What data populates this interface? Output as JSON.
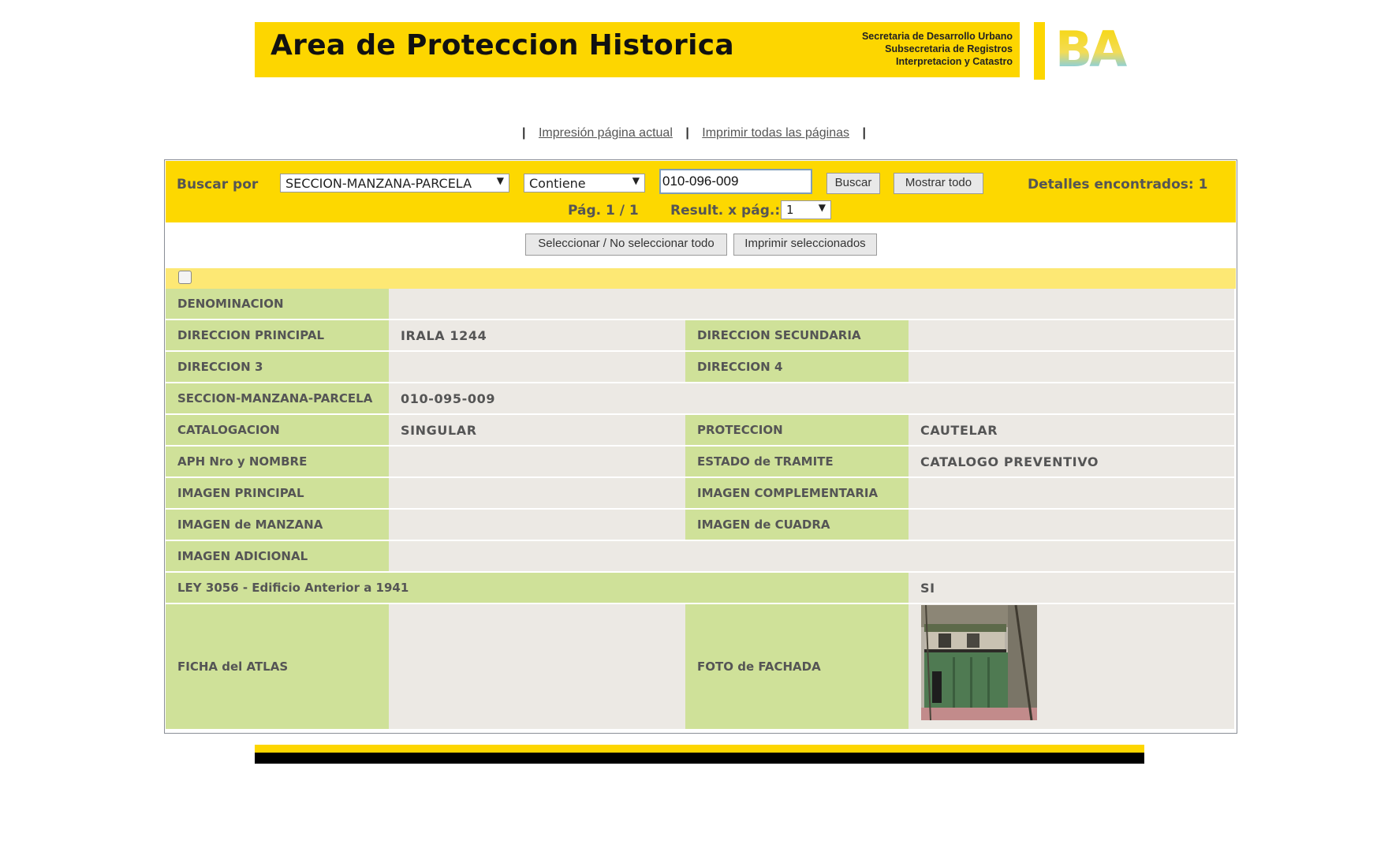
{
  "header": {
    "title": "Area de Proteccion Historica",
    "sub1": "Secretaria de Desarrollo Urbano",
    "sub2": "Subsecretaria de Registros",
    "sub3": "Interpretacion y Catastro",
    "logo_text": "BA"
  },
  "print_links": {
    "current": "Impresión página actual",
    "all": "Imprimir todas las páginas",
    "sep": "|"
  },
  "search": {
    "buscar_label": "Buscar por",
    "field_select": "SECCION-MANZANA-PARCELA",
    "mode_select": "Contiene",
    "query": "010-096-009",
    "buscar_btn": "Buscar",
    "mostrar_btn": "Mostrar todo",
    "found": "Detalles encontrados: 1",
    "page_info": "Pág. 1 / 1",
    "rpp_label": "Result. x pág.:",
    "rpp_value": "1"
  },
  "actions": {
    "select_all": "Seleccionar / No seleccionar todo",
    "print_selected": "Imprimir seleccionados"
  },
  "record": {
    "denominacion_label": "DENOMINACION",
    "denominacion": "",
    "dir_principal_label": "DIRECCION PRINCIPAL",
    "dir_principal": "IRALA 1244",
    "dir_secundaria_label": "DIRECCION SECUNDARIA",
    "dir_secundaria": "",
    "dir3_label": "DIRECCION 3",
    "dir3": "",
    "dir4_label": "DIRECCION 4",
    "dir4": "",
    "smp_label": "SECCION-MANZANA-PARCELA",
    "smp": "010-095-009",
    "catalogacion_label": "CATALOGACION",
    "catalogacion": "SINGULAR",
    "proteccion_label": "PROTECCION",
    "proteccion": "CAUTELAR",
    "aph_label": "APH Nro y NOMBRE",
    "aph": "",
    "estado_label": "ESTADO de TRAMITE",
    "estado": "CATALOGO PREVENTIVO",
    "img_principal_label": "IMAGEN PRINCIPAL",
    "img_complementaria_label": "IMAGEN COMPLEMENTARIA",
    "img_manzana_label": "IMAGEN de MANZANA",
    "img_cuadra_label": "IMAGEN de CUADRA",
    "img_adicional_label": "IMAGEN ADICIONAL",
    "ley_label": "LEY 3056 - Edificio Anterior a 1941",
    "ley": "SI",
    "ficha_label": "FICHA del ATLAS",
    "foto_label": "FOTO de FACHADA"
  },
  "colors": {
    "brand_yellow": "#fdd600",
    "label_green": "#cfe199",
    "value_grey": "#ece9e4"
  }
}
